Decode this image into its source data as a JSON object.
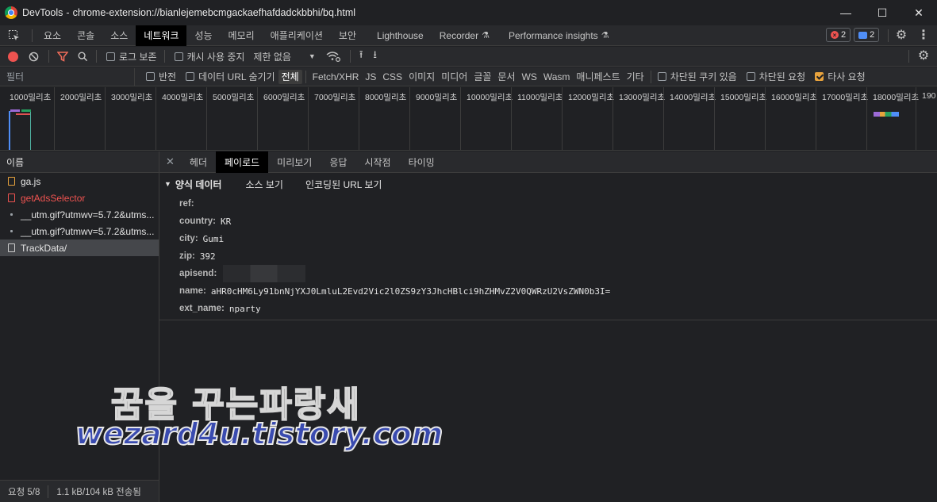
{
  "window": {
    "app_name": "DevTools",
    "url": "chrome-extension://bianlejemebcmgackaefhafdadckbbhi/bq.html",
    "controls": [
      "—",
      "☐",
      "✕"
    ]
  },
  "main_tabs": [
    {
      "label": "요소"
    },
    {
      "label": "콘솔"
    },
    {
      "label": "소스"
    },
    {
      "label": "네트워크"
    },
    {
      "label": "성능"
    },
    {
      "label": "메모리"
    },
    {
      "label": "애플리케이션"
    },
    {
      "label": "보안"
    },
    {
      "label": "Lighthouse"
    },
    {
      "label": "Recorder"
    },
    {
      "label": "Performance insights"
    }
  ],
  "badges": {
    "errors": "2",
    "messages": "2"
  },
  "toolbar": {
    "preserve_log": "로그 보존",
    "disable_cache": "캐시 사용 중지",
    "throttling": "제한 없음"
  },
  "filterbar": {
    "placeholder": "필터",
    "invert": "반전",
    "hide_data_urls": "데이터 URL 숨기기",
    "types": [
      "전체",
      "Fetch/XHR",
      "JS",
      "CSS",
      "이미지",
      "미디어",
      "글꼴",
      "문서",
      "WS",
      "Wasm",
      "매니페스트",
      "기타"
    ],
    "blocked_cookies": "차단된 쿠키 있음",
    "blocked_requests": "차단된 요청",
    "third_party": "타사 요청"
  },
  "timeline": {
    "ticks": [
      "1000밀리초",
      "2000밀리초",
      "3000밀리초",
      "4000밀리초",
      "5000밀리초",
      "6000밀리초",
      "7000밀리초",
      "8000밀리초",
      "9000밀리초",
      "10000밀리초",
      "11000밀리초",
      "12000밀리초",
      "13000밀리초",
      "14000밀리초",
      "15000밀리초",
      "16000밀리초",
      "17000밀리초",
      "18000밀리초",
      "190"
    ]
  },
  "requests": {
    "header": "이름",
    "rows": [
      {
        "name": "ga.js",
        "color": "#e8e8e8",
        "icon_color": "#e8a33d"
      },
      {
        "name": "getAdsSelector",
        "color": "#ef5350",
        "icon_color": "#ef5350"
      },
      {
        "name": "__utm.gif?utmwv=5.7.2&utms...",
        "color": "#e3e3e3",
        "icon_color": "#9aa0a6"
      },
      {
        "name": "__utm.gif?utmwv=5.7.2&utms...",
        "color": "#e3e3e3",
        "icon_color": "#9aa0a6"
      },
      {
        "name": "TrackData/",
        "color": "#e3e3e3",
        "icon_color": "#cccccc"
      }
    ],
    "footer_count": "요청 5/8",
    "footer_transfer": "1.1 kB/104 kB 전송됨"
  },
  "detail": {
    "tabs": [
      "헤더",
      "페이로드",
      "미리보기",
      "응답",
      "시작점",
      "타이밍"
    ],
    "section_title": "양식 데이터",
    "view_source": "소스 보기",
    "view_url_encoded": "인코딩된 URL 보기",
    "fields": [
      {
        "key": "ref:",
        "value": ""
      },
      {
        "key": "country:",
        "value": "KR"
      },
      {
        "key": "city:",
        "value": "Gumi"
      },
      {
        "key": "zip:",
        "value": "392"
      },
      {
        "key": "apisend:",
        "value": ""
      },
      {
        "key": "name:",
        "value": "aHR0cHM6Ly91bnNjYXJ0LmluL2Evd2Vic2l0ZS9zY3JhcHBlci9hZHMvZ2V0QWRzU2VsZWN0b3I="
      },
      {
        "key": "ext_name:",
        "value": "nparty"
      }
    ]
  },
  "watermark": {
    "line1": "꿈을 꾸는파랑새",
    "line2": "wezard4u.tistory.com"
  },
  "colors": {
    "accent_record": "#ef5350",
    "accent_filter": "#ef6c5a",
    "selected_tab": "#000000"
  }
}
